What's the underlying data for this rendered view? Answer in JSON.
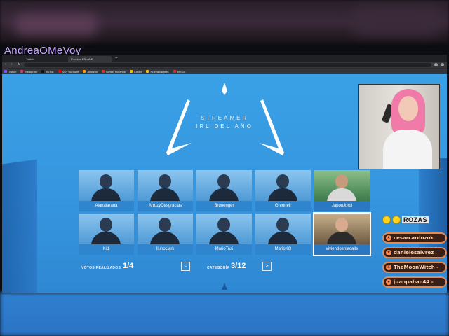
{
  "stream": {
    "channel_name": "AndreaOMeVoy"
  },
  "browser": {
    "tabs": [
      {
        "label": "Twitch"
      },
      {
        "label": "Premios ESLAND"
      }
    ],
    "bookmarks": [
      {
        "label": "Twitch",
        "color": "#9146ff"
      },
      {
        "label": "Instagram",
        "color": "#e1306c"
      },
      {
        "label": "TikTok",
        "color": "#111111"
      },
      {
        "label": "(20) YouTube",
        "color": "#ff0000"
      },
      {
        "label": "Amazon",
        "color": "#ff9900"
      },
      {
        "label": "Gmail_Horarios",
        "color": "#d93025"
      },
      {
        "label": "Coche",
        "color": "#fbbc04"
      },
      {
        "label": "Nueva carpeta",
        "color": "#fbbc04"
      },
      {
        "label": "MEGA",
        "color": "#d9272e"
      }
    ]
  },
  "page": {
    "title_line1": "STREAMER",
    "title_line2": "IRL DEL AÑO",
    "candidates": [
      {
        "name": "Alanalarana",
        "selected": false
      },
      {
        "name": "ArrozyDesgracias",
        "selected": false
      },
      {
        "name": "Brunenger",
        "selected": false
      },
      {
        "name": "Grenneir",
        "selected": false
      },
      {
        "name": "JaponJordi",
        "selected": false
      },
      {
        "name": "Kidi",
        "selected": false
      },
      {
        "name": "Ilunoclark",
        "selected": false
      },
      {
        "name": "MarioTasi",
        "selected": false
      },
      {
        "name": "MarioKQ",
        "selected": false
      },
      {
        "name": "viviendoenlacalle",
        "selected": true
      }
    ],
    "votes_label": "VOTOS REALIZADOS",
    "votes_value": "1/4",
    "category_label": "CATEGORÍA",
    "category_value": "3/12",
    "prev_label": "<",
    "next_label": ">"
  },
  "overlay": {
    "brand": "ROZAS",
    "subs": [
      {
        "name": "cesarcardozok",
        "icon": "star"
      },
      {
        "name": "danielesalvrez_",
        "icon": "heart"
      },
      {
        "name": "TheMoonWitch -",
        "icon": "dollar"
      },
      {
        "name": "juanpaban44 -",
        "icon": "drop"
      }
    ]
  }
}
